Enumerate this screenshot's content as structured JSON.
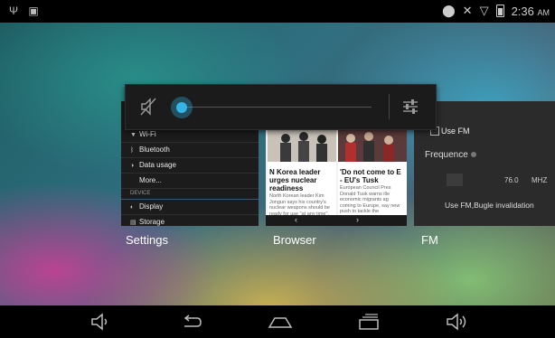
{
  "status_bar": {
    "time": "2:36",
    "ampm": "AM"
  },
  "recents": {
    "settings": {
      "label": "Settings",
      "items": [
        {
          "icon": "wifi-icon",
          "label": "Wi-Fi"
        },
        {
          "icon": "bluetooth-icon",
          "label": "Bluetooth"
        },
        {
          "icon": "data-usage-icon",
          "label": "Data usage"
        },
        {
          "icon": "",
          "label": "More..."
        },
        {
          "icon": "",
          "label": "DEVICE",
          "header": true
        },
        {
          "icon": "display-icon",
          "label": "Display"
        },
        {
          "icon": "storage-icon",
          "label": "Storage"
        }
      ]
    },
    "browser": {
      "label": "Browser",
      "left_title": "N Korea leader urges nuclear readiness",
      "left_body": "North Korean leader Kim Jongun says his country's nuclear weapons should be ready for use \"at any time\", state media reports",
      "right_title": "'Do not come to E - EU's Tusk",
      "right_body": "European Council Pres Donald Tusk warns ille economic migrants ag coming to Europe, say new push to tackle the"
    },
    "fm": {
      "label": "FM",
      "use_fm": "Use FM",
      "frequence": "Frequence",
      "value": "76.0",
      "unit": "MHZ",
      "note": "Use FM,Bugle invalidation"
    }
  },
  "volume": {
    "level": 0.0
  },
  "colors": {
    "accent": "#33b5e5"
  }
}
